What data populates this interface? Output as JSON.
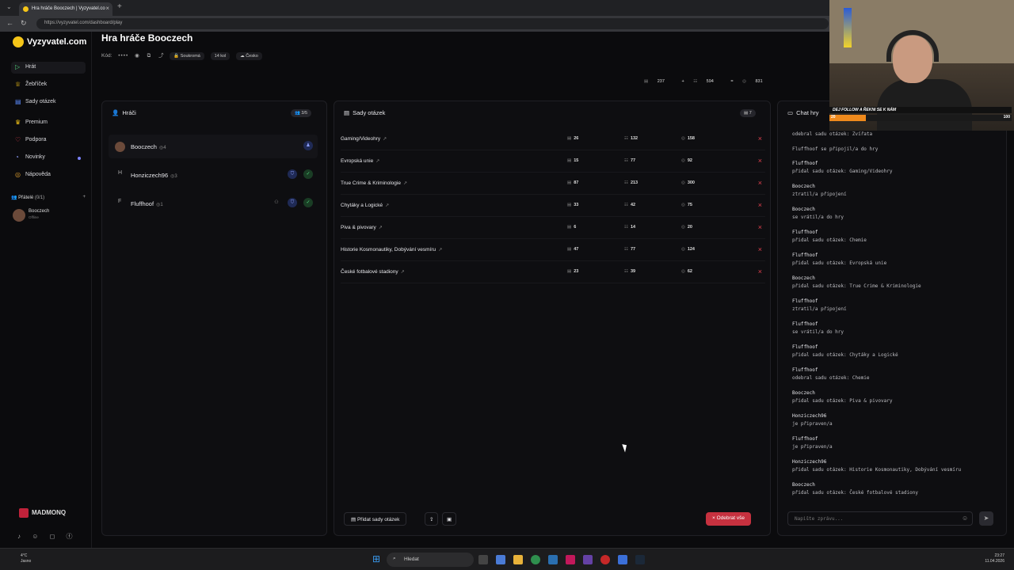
{
  "browser": {
    "tab_title": "Hra hráče Booczech | Vyzyvatel.co",
    "url": "https://vyzyvatel.com/dashboard/play"
  },
  "sidebar": {
    "brand": "Vyzyvatel.com",
    "items": [
      {
        "label": "Hrát",
        "icon": "play-icon"
      },
      {
        "label": "Žebříček",
        "icon": "trophy-icon"
      },
      {
        "label": "Sady otázek",
        "icon": "book-icon"
      },
      {
        "label": "Premium",
        "icon": "crown-icon"
      },
      {
        "label": "Podpora",
        "icon": "heart-icon"
      },
      {
        "label": "Novinky",
        "icon": "bell-icon"
      },
      {
        "label": "Nápověda",
        "icon": "help-icon"
      }
    ],
    "friends_label": "Přátelé",
    "friends_count": "(0/1)",
    "friend": {
      "name": "Booczech",
      "status": "Offline"
    },
    "sponsor": "MADMONQ",
    "socials": [
      "tiktok-icon",
      "discord-icon",
      "instagram-icon",
      "facebook-icon"
    ]
  },
  "game": {
    "title": "Hra hráče Booczech",
    "code_label": "Kód:",
    "code_value": "••••",
    "privacy": "Soukromá",
    "rounds": "14 kol",
    "language": "Česko"
  },
  "players_panel": {
    "title": "Hráči",
    "count": "3/5",
    "players": [
      {
        "name": "Booczech",
        "score": "4",
        "initial": ""
      },
      {
        "name": "Honziczech96",
        "score": "3",
        "initial": "H"
      },
      {
        "name": "Fluffhoof",
        "score": "1",
        "initial": "F"
      }
    ]
  },
  "sets_panel": {
    "title": "Sady otázek",
    "totals": {
      "a": "237",
      "b": "594",
      "c": "831"
    },
    "set_count": "7",
    "sets": [
      {
        "name": "Gaming/Videohry",
        "a": "26",
        "b": "132",
        "c": "158"
      },
      {
        "name": "Evropská unie",
        "a": "15",
        "b": "77",
        "c": "92"
      },
      {
        "name": "True Crime & Kriminologie",
        "a": "87",
        "b": "213",
        "c": "300"
      },
      {
        "name": "Chytáky a Logické",
        "a": "33",
        "b": "42",
        "c": "75"
      },
      {
        "name": "Piva & pivovary",
        "a": "6",
        "b": "14",
        "c": "20"
      },
      {
        "name": "Historie Kosmonautiky, Dobývání vesmíru",
        "a": "47",
        "b": "77",
        "c": "124"
      },
      {
        "name": "České fotbalové stadiony",
        "a": "23",
        "b": "39",
        "c": "62"
      }
    ],
    "add_button": "Přidat sady otázek",
    "remove_all_button": "Odebrat vše"
  },
  "chat": {
    "title": "Chat hry",
    "messages": [
      {
        "who": "",
        "text": "odebral sadu otázek: Zvířata"
      },
      {
        "who": "",
        "text": "Fluffhoof se připojil/a do hry"
      },
      {
        "who": "Fluffhoof",
        "text": "přidal sadu otázek: Gaming/Videohry"
      },
      {
        "who": "Booczech",
        "text": "ztratil/a připojení"
      },
      {
        "who": "Booczech",
        "text": "se vrátil/a do hry"
      },
      {
        "who": "Fluffhoof",
        "text": "přidal sadu otázek: Chemie"
      },
      {
        "who": "Fluffhoof",
        "text": "přidal sadu otázek: Evropská unie"
      },
      {
        "who": "Booczech",
        "text": "přidal sadu otázek: True Crime & Kriminologie"
      },
      {
        "who": "Fluffhoof",
        "text": "ztratil/a připojení"
      },
      {
        "who": "Fluffhoof",
        "text": "se vrátil/a do hry"
      },
      {
        "who": "Fluffhoof",
        "text": "přidal sadu otázek: Chytáky a Logické"
      },
      {
        "who": "Fluffhoof",
        "text": "odebral sadu otázek: Chemie"
      },
      {
        "who": "Booczech",
        "text": "přidal sadu otázek: Piva & pivovary"
      },
      {
        "who": "Honziczech96",
        "text": "je připraven/a"
      },
      {
        "who": "Fluffhoof",
        "text": "je připraven/a"
      },
      {
        "who": "Honziczech96",
        "text": "přidal sadu otázek: Historie Kosmonautiky, Dobývání vesmíru"
      },
      {
        "who": "Booczech",
        "text": "přidal sadu otázek: České fotbalové stadiony"
      }
    ],
    "placeholder": "Napište zprávu..."
  },
  "taskbar": {
    "search": "Hledat",
    "weather_temp": "4°C",
    "weather_desc": "Jasno",
    "time": "23:27",
    "date": "11.04.2026"
  },
  "webcam": {
    "banner": "DEJ FOLLOW A ŘEKNI SE K NÁM",
    "bar_low": "20",
    "bar_high": "100",
    "bar_fill": 0.2
  },
  "colors": {
    "accent_red": "#c6313f",
    "brand_yellow": "#f5c518",
    "ready_green": "#52d27b"
  }
}
